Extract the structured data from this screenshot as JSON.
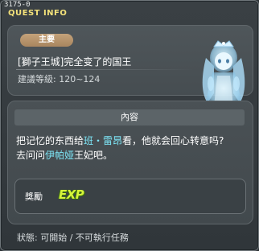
{
  "window": {
    "quest_id": "3175-0",
    "title": "QUEST INFO"
  },
  "header": {
    "tag": "主要",
    "quest_name": "[獅子王城]完全变了的国王",
    "level_range": "建議等級: 120~124"
  },
  "content": {
    "section_title": "內容",
    "desc_line1_pre": "把记忆的东西给",
    "desc_line1_npc": "班・雷昂",
    "desc_line1_post": "看，他就会回心转意吗?",
    "desc_line2_pre": "去问问",
    "desc_line2_npc": "伊帕娅",
    "desc_line2_post": "王妃吧。",
    "highlight_color": "#7ee7f8"
  },
  "reward": {
    "label": "獎勵",
    "exp_label": "EXP"
  },
  "status": {
    "text": "狀態: 可開始 / 不可執行任務"
  },
  "icons": {
    "npc_portrait": "ghost-queen-npc-icon"
  }
}
